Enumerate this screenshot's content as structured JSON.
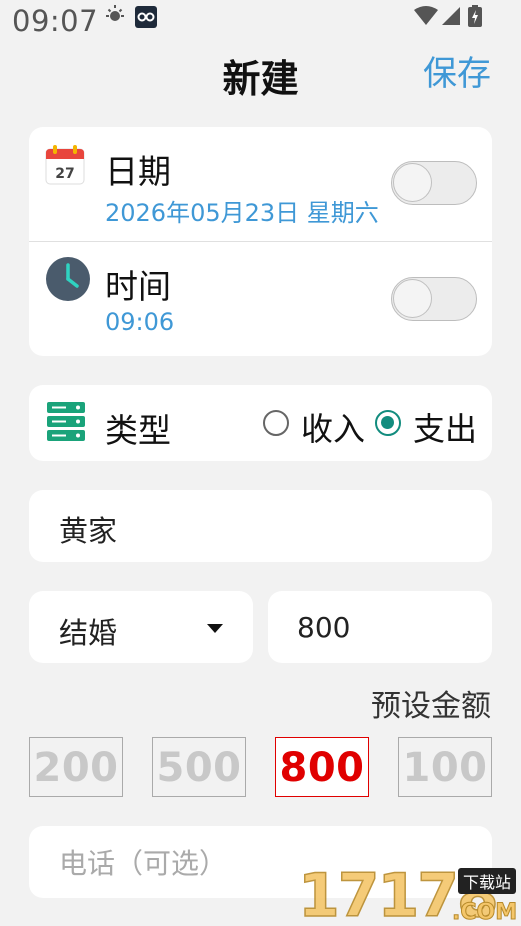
{
  "status_bar": {
    "time": "09:07"
  },
  "header": {
    "title": "新建",
    "save_label": "保存"
  },
  "date_row": {
    "label": "日期",
    "value": "2026年05月23日 星期六",
    "calendar_day": "27",
    "toggle_on": false
  },
  "time_row": {
    "label": "时间",
    "value": "09:06",
    "toggle_on": false
  },
  "type_row": {
    "label": "类型",
    "options": [
      "收入",
      "支出"
    ],
    "selected": "支出"
  },
  "name_field": {
    "value": "黄家"
  },
  "event_select": {
    "value": "结婚"
  },
  "amount_field": {
    "value": "800"
  },
  "presets": {
    "label": "预设金额",
    "values": [
      "200",
      "500",
      "800",
      "100"
    ],
    "selected": "800"
  },
  "phone_field": {
    "placeholder": "电话（可选）"
  },
  "watermark": {
    "site": "17178",
    "domain": ".COM",
    "tag": "下载站"
  },
  "colors": {
    "accent": "#3f98d6",
    "radio_checked": "#128c7e",
    "preset_selected": "#e00000",
    "background": "#f2f2f2"
  }
}
